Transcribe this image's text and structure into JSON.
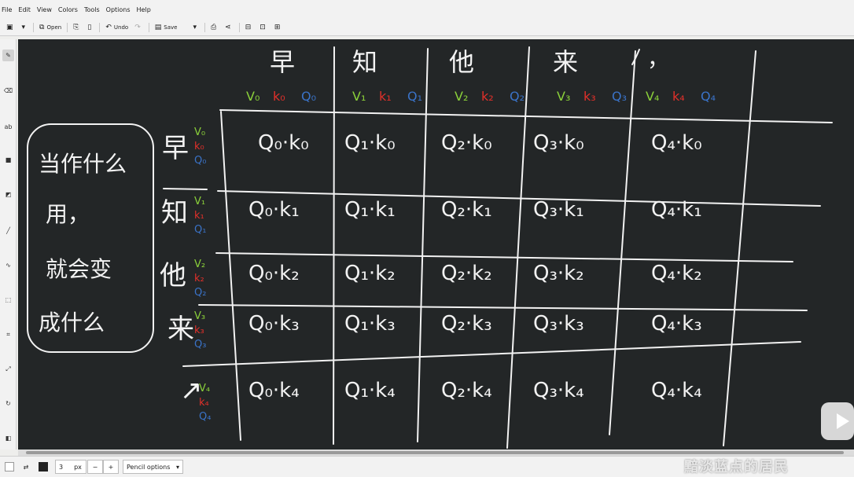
{
  "menu": [
    "File",
    "Edit",
    "View",
    "Colors",
    "Tools",
    "Options",
    "Help"
  ],
  "toolbar": {
    "open": "Open",
    "undo": "Undo",
    "save": "Save"
  },
  "status": {
    "size": "3",
    "unit": "px",
    "minus": "−",
    "plus": "+",
    "pencil_options": "Pencil options"
  },
  "watermark": "黯淡蓝点的居民",
  "board": {
    "header_words": [
      "早",
      "知",
      "他",
      "来",
      "，"
    ],
    "header_vars": [
      [
        "V₀",
        "k₀",
        "Q₀"
      ],
      [
        "V₁",
        "k₁",
        "Q₁"
      ],
      [
        "V₂",
        "k₂",
        "Q₂"
      ],
      [
        "V₃",
        "k₃",
        "Q₃"
      ],
      [
        "V₄",
        "k₄",
        "Q₄"
      ]
    ],
    "row_words": [
      "早",
      "知",
      "他",
      "来",
      "↗"
    ],
    "row_vars": [
      [
        "V₀",
        "k₀",
        "Q₀"
      ],
      [
        "V₁",
        "k₁",
        "Q₁"
      ],
      [
        "V₂",
        "k₂",
        "Q₂"
      ],
      [
        "V₃",
        "k₃",
        "Q₃"
      ],
      [
        "V₄",
        "k₄",
        "Q₄"
      ]
    ],
    "cells": [
      [
        "Q₀·k₀",
        "Q₁·k₀",
        "Q₂·k₀",
        "Q₃·k₀",
        "Q₄·k₀"
      ],
      [
        "Q₀·k₁",
        "Q₁·k₁",
        "Q₂·k₁",
        "Q₃·k₁",
        "Q₄·k₁"
      ],
      [
        "Q₀·k₂",
        "Q₁·k₂",
        "Q₂·k₂",
        "Q₃·k₂",
        "Q₄·k₂"
      ],
      [
        "Q₀·k₃",
        "Q₁·k₃",
        "Q₂·k₃",
        "Q₃·k₃",
        "Q₄·k₃"
      ],
      [
        "Q₀·k₄",
        "Q₁·k₄",
        "Q₂·k₄",
        "Q₃·k₄",
        "Q₄·k₄"
      ]
    ],
    "note_lines": [
      "当作什么",
      "用，",
      "就会变",
      "成什么"
    ]
  },
  "colors": {
    "green": "#8bd13a",
    "red": "#e0302a",
    "blue": "#3a73c8",
    "chalk": "#f2f2f2",
    "board": "#232627"
  }
}
